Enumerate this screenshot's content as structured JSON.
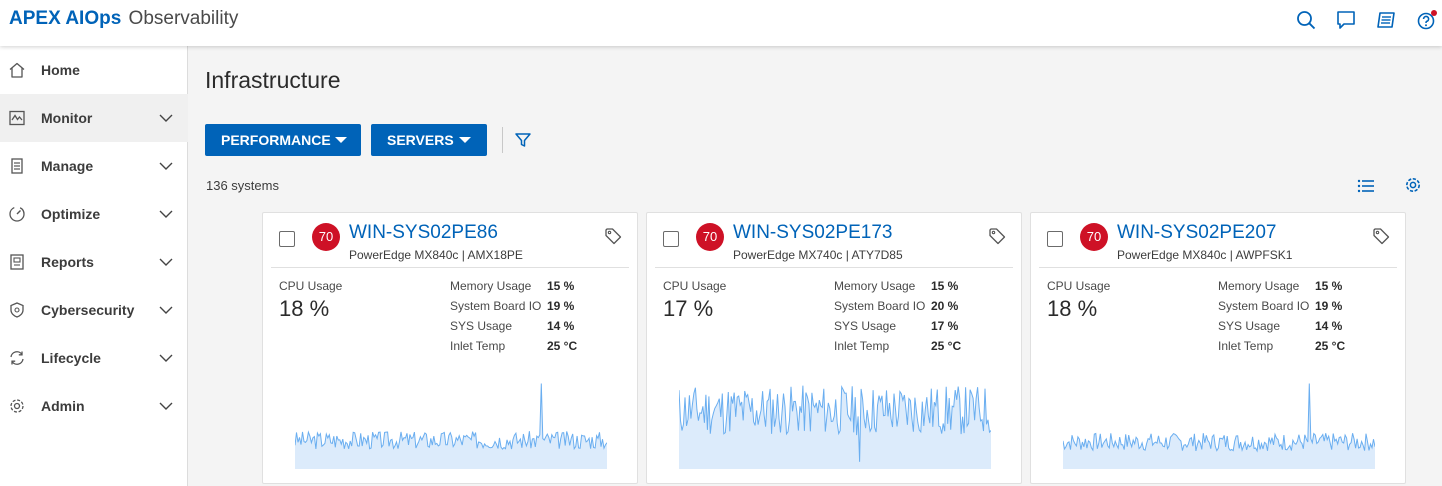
{
  "header": {
    "brand_bold": "APEX AIOps",
    "brand_light": "Observability",
    "icons": [
      "search-icon",
      "chat-icon",
      "news-icon",
      "help-icon"
    ]
  },
  "sidebar": {
    "items": [
      {
        "label": "Home",
        "icon": "home-icon",
        "expandable": false,
        "active": false
      },
      {
        "label": "Monitor",
        "icon": "monitor-icon",
        "expandable": true,
        "active": true
      },
      {
        "label": "Manage",
        "icon": "manage-icon",
        "expandable": true,
        "active": false
      },
      {
        "label": "Optimize",
        "icon": "optimize-icon",
        "expandable": true,
        "active": false
      },
      {
        "label": "Reports",
        "icon": "reports-icon",
        "expandable": true,
        "active": false
      },
      {
        "label": "Cybersecurity",
        "icon": "shield-icon",
        "expandable": true,
        "active": false
      },
      {
        "label": "Lifecycle",
        "icon": "lifecycle-icon",
        "expandable": true,
        "active": false
      },
      {
        "label": "Admin",
        "icon": "gear-icon",
        "expandable": true,
        "active": false
      }
    ]
  },
  "main": {
    "title": "Infrastructure",
    "performance_label": "PERFORMANCE",
    "servers_label": "SERVERS",
    "count_text": "136 systems"
  },
  "cards": [
    {
      "score": "70",
      "name": "WIN-SYS02PE86",
      "model": "PowerEdge MX840c | AMX18PE",
      "cpu_label": "CPU Usage",
      "cpu_value": "18 %",
      "metrics": [
        {
          "label": "Memory Usage",
          "value": "15 %"
        },
        {
          "label": "System Board IO",
          "value": "19 %"
        },
        {
          "label": "SYS Usage",
          "value": "14 %"
        },
        {
          "label": "Inlet Temp",
          "value": "25 °C"
        }
      ],
      "spark": {
        "base": 0.32,
        "amp": 0.1,
        "spike_at": 0.79,
        "spike": 0.95,
        "seed": 3
      }
    },
    {
      "score": "70",
      "name": "WIN-SYS02PE173",
      "model": "PowerEdge MX740c | ATY7D85",
      "cpu_label": "CPU Usage",
      "cpu_value": "17 %",
      "metrics": [
        {
          "label": "Memory Usage",
          "value": "15 %"
        },
        {
          "label": "System Board IO",
          "value": "20 %"
        },
        {
          "label": "SYS Usage",
          "value": "17 %"
        },
        {
          "label": "Inlet Temp",
          "value": "25 °C"
        }
      ],
      "spark": {
        "base": 0.65,
        "amp": 0.28,
        "spike_at": 0.58,
        "spike": 0.08,
        "seed": 11
      }
    },
    {
      "score": "70",
      "name": "WIN-SYS02PE207",
      "model": "PowerEdge MX840c | AWPFSK1",
      "cpu_label": "CPU Usage",
      "cpu_value": "18 %",
      "metrics": [
        {
          "label": "Memory Usage",
          "value": "15 %"
        },
        {
          "label": "System Board IO",
          "value": "19 %"
        },
        {
          "label": "SYS Usage",
          "value": "14 %"
        },
        {
          "label": "Inlet Temp",
          "value": "25 °C"
        }
      ],
      "spark": {
        "base": 0.3,
        "amp": 0.1,
        "spike_at": 0.79,
        "spike": 0.95,
        "seed": 7
      }
    }
  ],
  "colors": {
    "accent": "#0063b8",
    "score_badge": "#ce1126",
    "spark_line": "#6aaef0",
    "spark_fill": "#dcebfb"
  }
}
